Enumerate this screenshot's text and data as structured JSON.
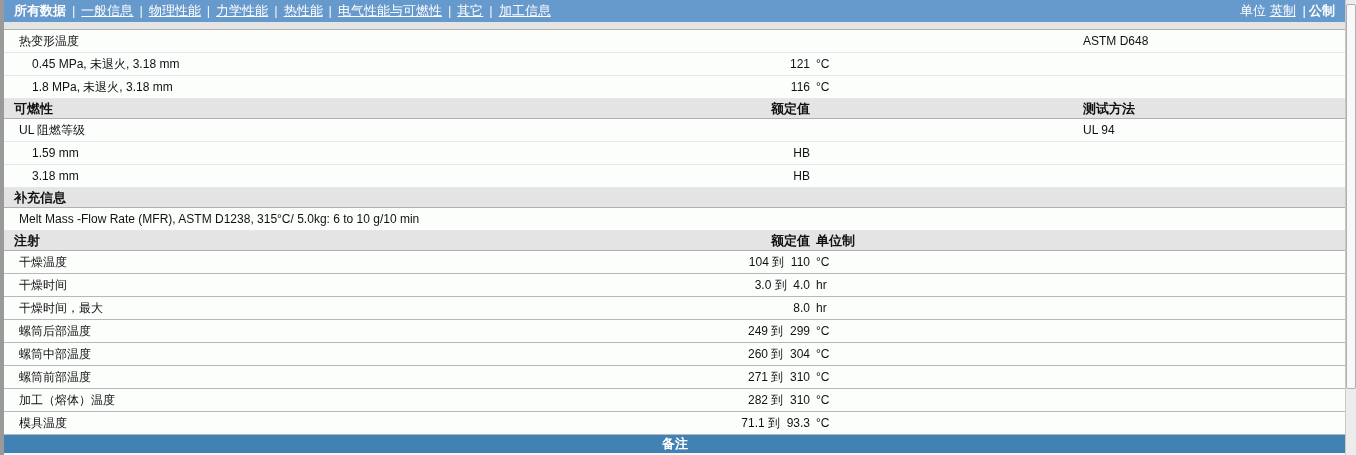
{
  "nav": {
    "separator": "|",
    "items": [
      {
        "label": "所有数据",
        "selected": true
      },
      {
        "label": "一般信息",
        "selected": false
      },
      {
        "label": "物理性能",
        "selected": false
      },
      {
        "label": "力学性能",
        "selected": false
      },
      {
        "label": "热性能",
        "selected": false
      },
      {
        "label": "电气性能与可燃性",
        "selected": false
      },
      {
        "label": "其它",
        "selected": false
      },
      {
        "label": "加工信息",
        "selected": false
      }
    ],
    "units": {
      "label": "单位",
      "separator": "|",
      "options": [
        {
          "label": "英制",
          "selected": false
        },
        {
          "label": "公制",
          "selected": true
        }
      ]
    }
  },
  "sections": [
    {
      "rows": [
        {
          "kind": "group",
          "label": "热变形温度",
          "method": "ASTM D648"
        },
        {
          "kind": "sub",
          "label": "0.45 MPa, 未退火, 3.18 mm",
          "value": "121",
          "unit": "°C"
        },
        {
          "kind": "sub",
          "label": "1.8 MPa, 未退火, 3.18 mm",
          "value": "116",
          "unit": "°C"
        }
      ]
    },
    {
      "title": "可燃性",
      "value_heading": "额定值",
      "method_heading": "测试方法",
      "rows": [
        {
          "kind": "group",
          "label": "UL 阻燃等级",
          "method": "UL 94"
        },
        {
          "kind": "sub",
          "label": "1.59 mm",
          "value": "HB"
        },
        {
          "kind": "sub",
          "label": "3.18 mm",
          "value": "HB"
        }
      ]
    },
    {
      "title": "补充信息",
      "rows": [
        {
          "kind": "note",
          "label": "Melt Mass -Flow Rate (MFR), ASTM D1238, 315°C/ 5.0kg: 6 to 10 g/10 min"
        }
      ]
    },
    {
      "title": "注射",
      "value_heading": "额定值",
      "unit_heading": "单位制",
      "rows": [
        {
          "kind": "plain",
          "label": "干燥温度",
          "value": "104 到  110",
          "unit": "°C"
        },
        {
          "kind": "plain",
          "label": "干燥时间",
          "value": "3.0 到  4.0",
          "unit": "hr"
        },
        {
          "kind": "plain",
          "label": "干燥时间，最大",
          "value": "8.0",
          "unit": "hr"
        },
        {
          "kind": "plain",
          "label": "螺筒后部温度",
          "value": "249 到  299",
          "unit": "°C"
        },
        {
          "kind": "plain",
          "label": "螺筒中部温度",
          "value": "260 到  304",
          "unit": "°C"
        },
        {
          "kind": "plain",
          "label": "螺筒前部温度",
          "value": "271 到  310",
          "unit": "°C"
        },
        {
          "kind": "plain",
          "label": "加工（熔体）温度",
          "value": "282 到  310",
          "unit": "°C"
        },
        {
          "kind": "plain",
          "label": "模具温度",
          "value": "71.1 到  93.3",
          "unit": "°C"
        }
      ]
    }
  ],
  "footer": {
    "title": "备注"
  }
}
